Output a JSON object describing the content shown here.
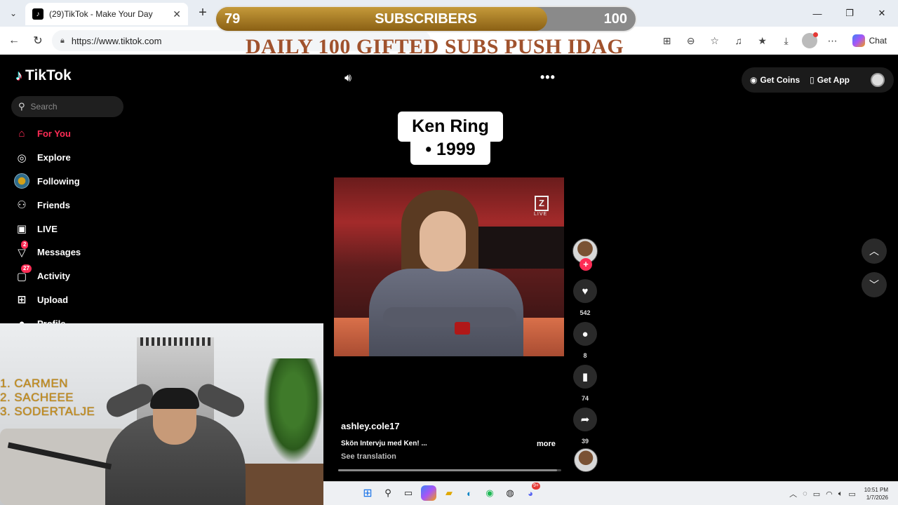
{
  "browser": {
    "tab_title": "(29)TikTok - Make Your Day",
    "url": "https://www.tiktok.com",
    "chat_label": "Chat"
  },
  "overlay": {
    "sub_current": "79",
    "sub_label": "SUBSCRIBERS",
    "sub_goal": "100",
    "sub_progress": 0.79,
    "banner": "DAILY 100  GIFTED SUBS PUSH IDAG",
    "leaderboard": [
      "1.  CARMEN",
      "2.  SACHEEE",
      "3.  SODERTALJE"
    ]
  },
  "tiktok": {
    "logo_text": "TikTok",
    "search_placeholder": "Search",
    "nav": [
      {
        "label": "For You",
        "icon": "home-icon"
      },
      {
        "label": "Explore",
        "icon": "compass-icon"
      },
      {
        "label": "Following",
        "icon": "following-avatar"
      },
      {
        "label": "Friends",
        "icon": "friends-icon"
      },
      {
        "label": "LIVE",
        "icon": "live-icon"
      },
      {
        "label": "Messages",
        "icon": "messages-icon",
        "badge": "2"
      },
      {
        "label": "Activity",
        "icon": "activity-icon",
        "badge": "27"
      },
      {
        "label": "Upload",
        "icon": "upload-icon"
      },
      {
        "label": "Profile",
        "icon": "profile-icon"
      }
    ],
    "get_coins": "Get Coins",
    "get_app": "Get App",
    "caption_line1": "Ken Ring",
    "caption_line2": "• 1999",
    "video_watermark": "Z",
    "video_watermark_sub": "LIVE",
    "likes": "542",
    "comments": "8",
    "saves": "74",
    "shares": "39",
    "username": "ashley.cole17",
    "description": "Skön Intervju med Ken! ...",
    "more": "more",
    "see_translation": "See translation",
    "video_progress": 0.98
  },
  "taskbar": {
    "time": "10:51 PM",
    "date": "1/7/2026",
    "notification_badge": "9+"
  },
  "colors": {
    "accent": "#fe2c55",
    "gold": "#c8901c",
    "banner": "#a0522d"
  }
}
